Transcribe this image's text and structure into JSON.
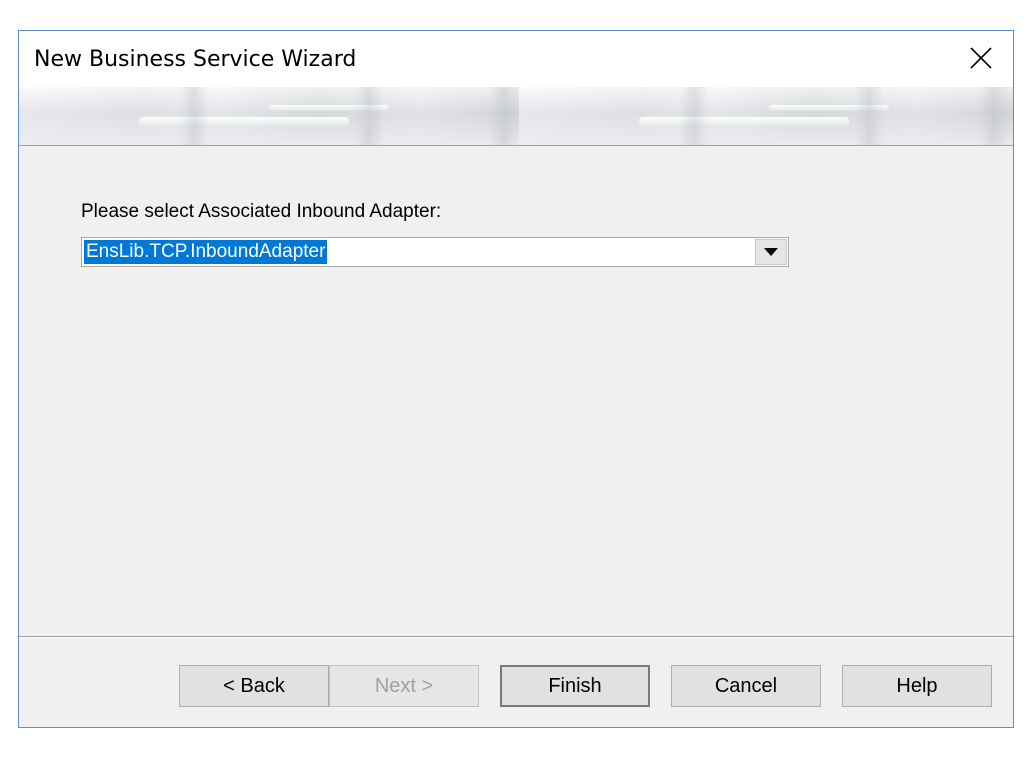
{
  "window": {
    "title": "New Business Service Wizard"
  },
  "form": {
    "adapter_label": "Please select Associated Inbound Adapter:",
    "adapter_value": "EnsLib.TCP.InboundAdapter"
  },
  "buttons": {
    "back": "< Back",
    "next": "Next >",
    "finish": "Finish",
    "cancel": "Cancel",
    "help": "Help"
  },
  "colors": {
    "window_border": "#5b8fcf",
    "selection": "#0078d7",
    "dialog_bg": "#f0f0f0"
  },
  "icons": {
    "close": "close-icon",
    "dropdown": "dropdown-arrow-icon"
  }
}
